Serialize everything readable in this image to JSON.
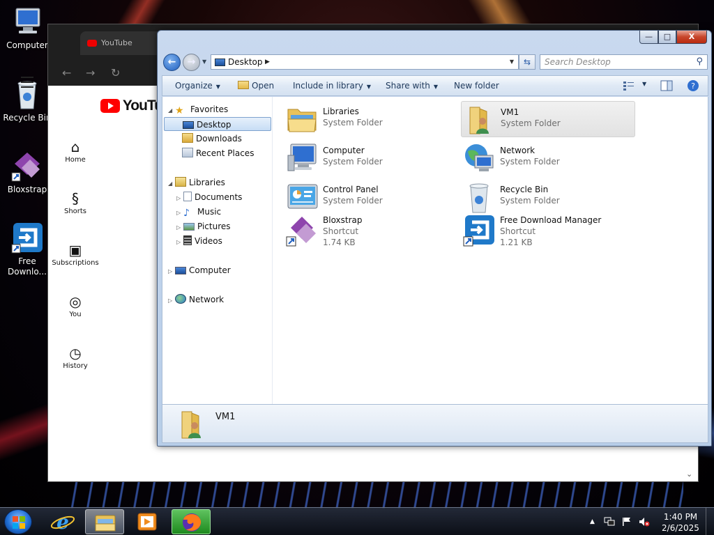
{
  "desktop": {
    "icons": [
      {
        "label": "Computer"
      },
      {
        "label": "Recycle Bin"
      },
      {
        "label": "Bloxstrap"
      },
      {
        "label": "Free\nDownlo..."
      }
    ]
  },
  "browser": {
    "tab_title": "YouTube",
    "logo_text": "YouTube",
    "nav": [
      {
        "label": "Home",
        "icon": "home-icon"
      },
      {
        "label": "Shorts",
        "icon": "shorts-icon"
      },
      {
        "label": "Subscriptions",
        "icon": "subscriptions-icon"
      },
      {
        "label": "You",
        "icon": "you-icon"
      },
      {
        "label": "History",
        "icon": "history-icon"
      }
    ]
  },
  "explorer": {
    "caption": {
      "minimize": "—",
      "maximize": "□",
      "close": "X"
    },
    "address": {
      "location": "Desktop"
    },
    "search": {
      "placeholder": "Search Desktop"
    },
    "commands": {
      "organize": "Organize",
      "open": "Open",
      "include_in_library": "Include in library",
      "share_with": "Share with",
      "new_folder": "New folder"
    },
    "nav_tree": {
      "favorites": "Favorites",
      "desktop": "Desktop",
      "downloads": "Downloads",
      "recent_places": "Recent Places",
      "libraries": "Libraries",
      "documents": "Documents",
      "music": "Music",
      "pictures": "Pictures",
      "videos": "Videos",
      "computer": "Computer",
      "network": "Network"
    },
    "items": [
      {
        "name": "Libraries",
        "type": "System Folder",
        "size": ""
      },
      {
        "name": "VM1",
        "type": "System Folder",
        "size": ""
      },
      {
        "name": "Computer",
        "type": "System Folder",
        "size": ""
      },
      {
        "name": "Network",
        "type": "System Folder",
        "size": ""
      },
      {
        "name": "Control Panel",
        "type": "System Folder",
        "size": ""
      },
      {
        "name": "Recycle Bin",
        "type": "System Folder",
        "size": ""
      },
      {
        "name": "Bloxstrap",
        "type": "Shortcut",
        "size": "1.74 KB"
      },
      {
        "name": "Free Download Manager",
        "type": "Shortcut",
        "size": "1.21 KB"
      }
    ],
    "details": {
      "selected_name": "VM1"
    }
  },
  "taskbar": {
    "time": "1:40 PM",
    "date": "2/6/2025"
  },
  "colors": {
    "accent_blue": "#1f5fbf",
    "youtube_red": "#ff0000",
    "close_red": "#c7452b"
  }
}
